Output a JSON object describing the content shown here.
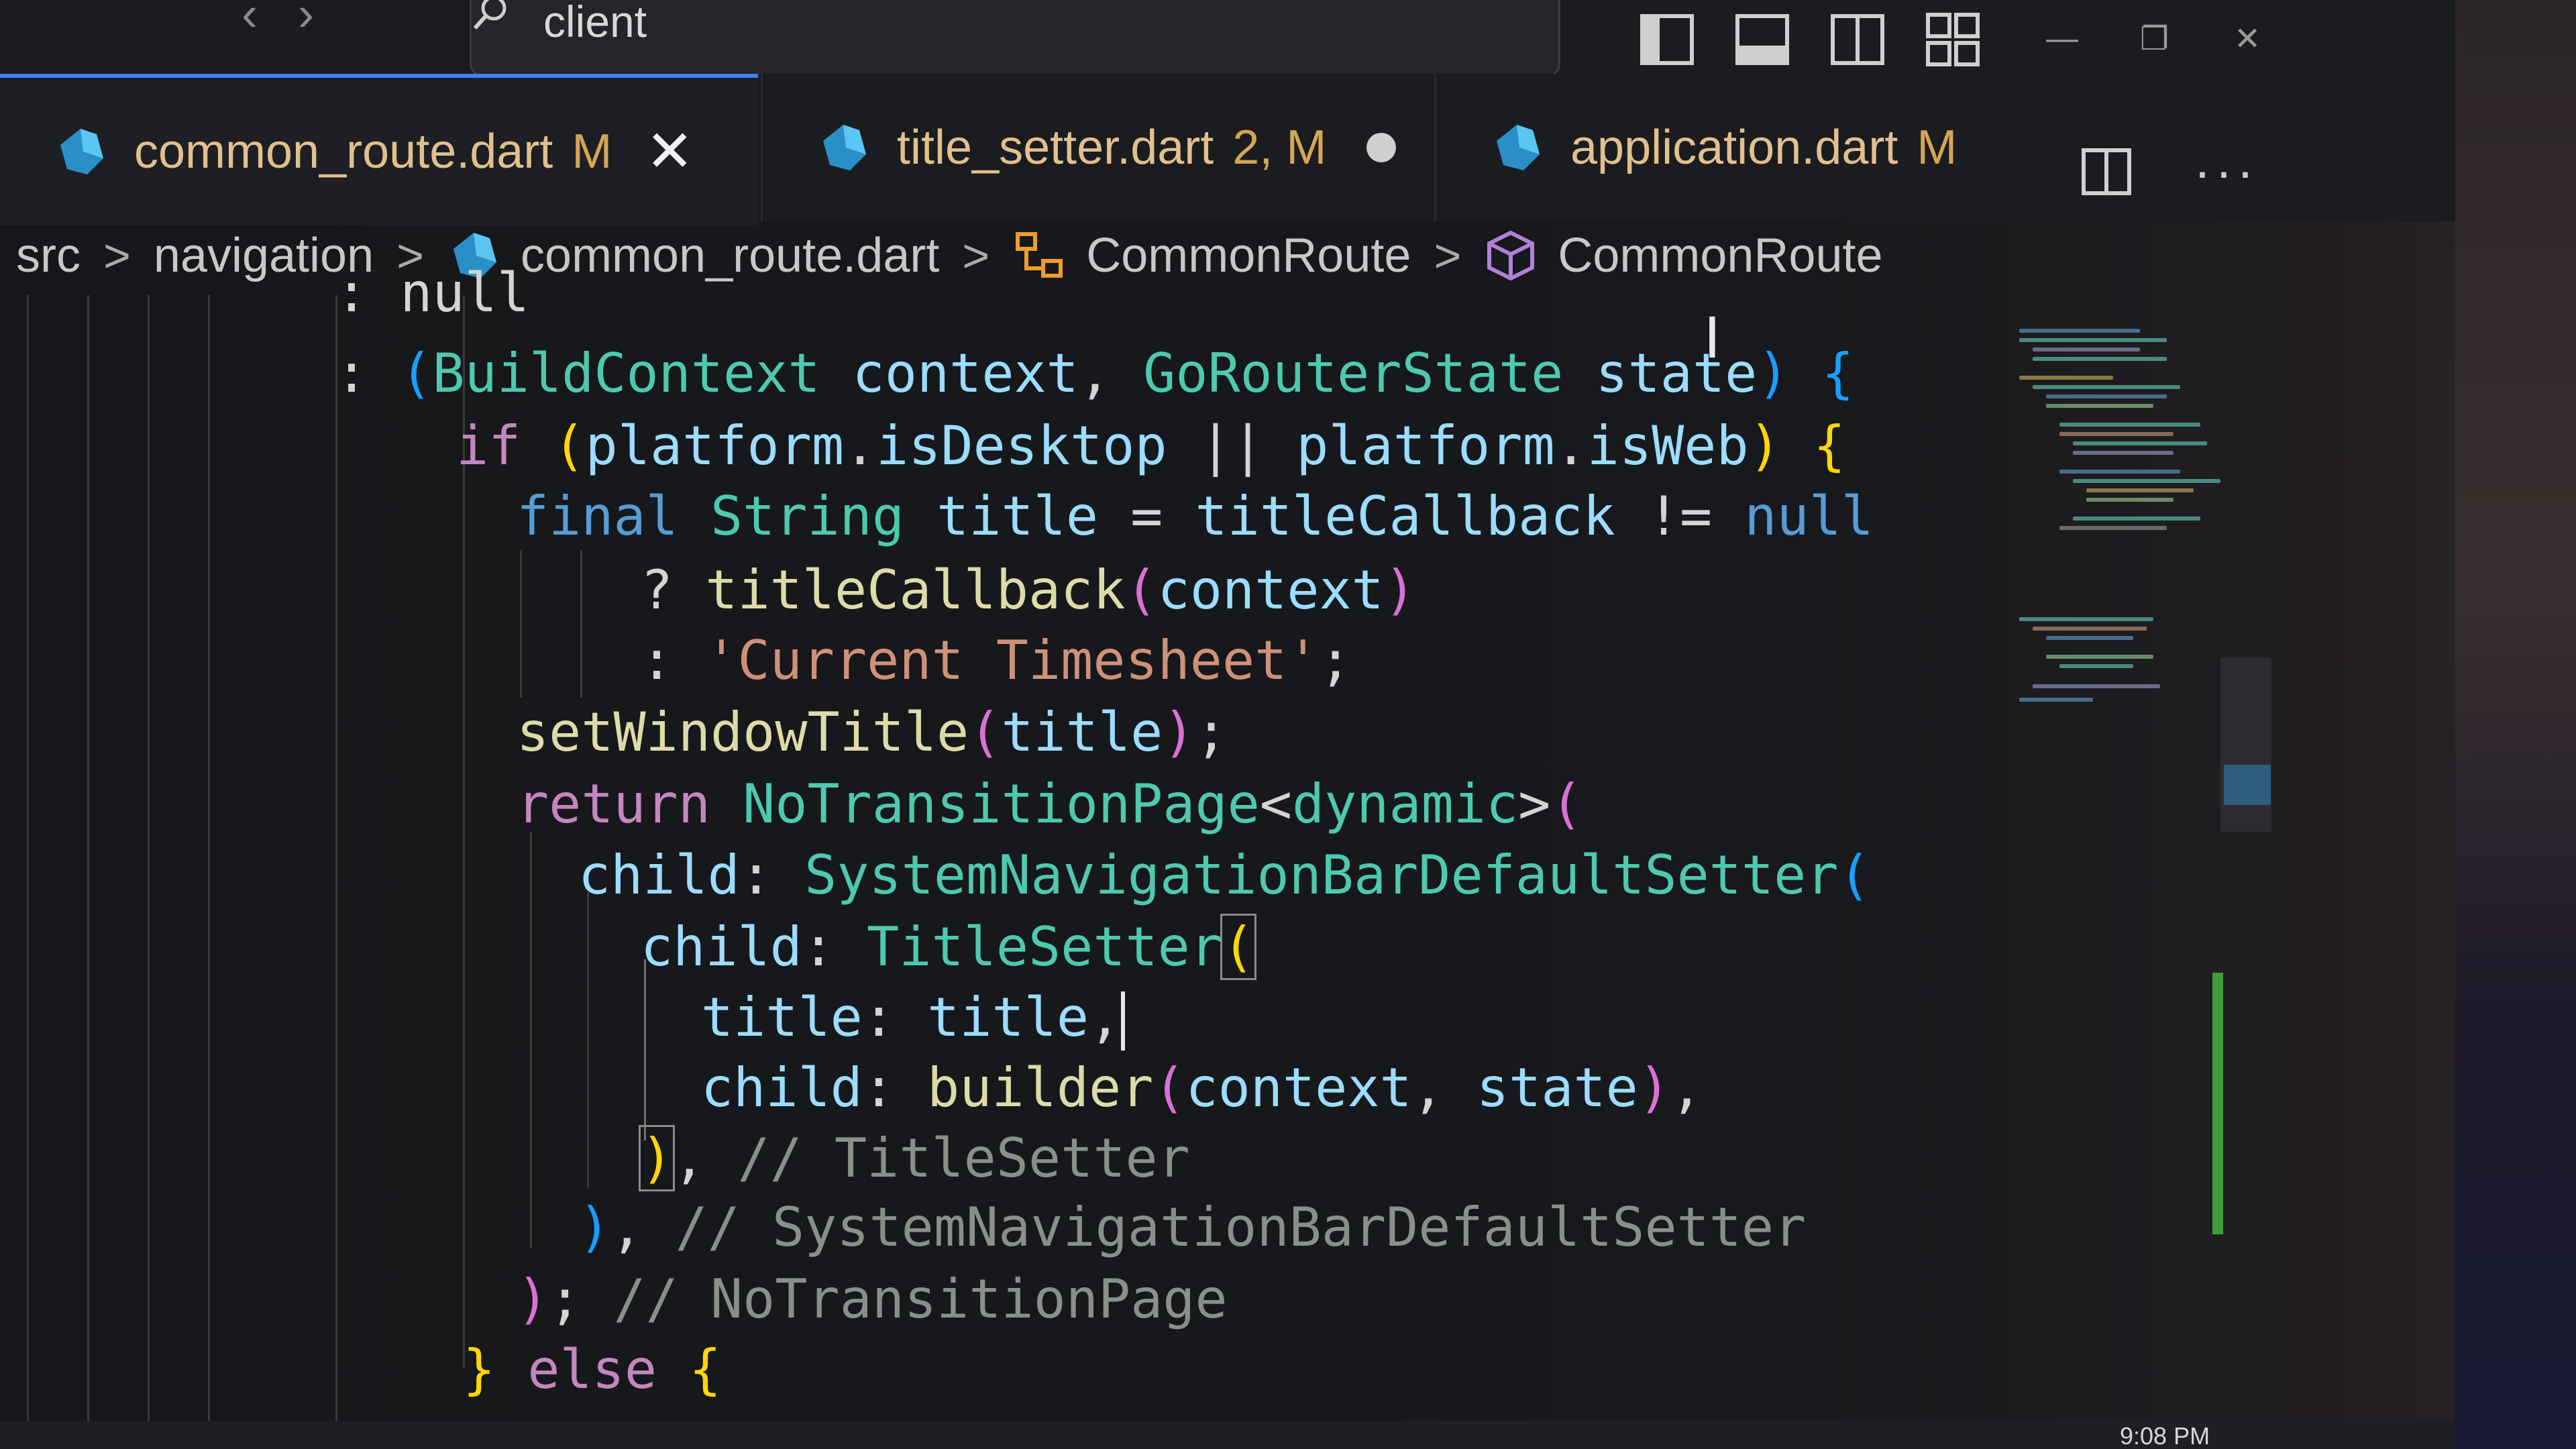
{
  "search": {
    "text": "client"
  },
  "tabs": [
    {
      "name": "common_route.dart",
      "status": "M",
      "active": true
    },
    {
      "name": "title_setter.dart",
      "status": "2, M",
      "unsaved": true
    },
    {
      "name": "application.dart",
      "status": "M"
    }
  ],
  "breadcrumb": {
    "items": [
      "src",
      "navigation",
      "common_route.dart",
      "CommonRoute",
      "CommonRoute"
    ],
    "separator": ">"
  },
  "icons": {
    "tab_file_icon": "dart-file-icon",
    "breadcrumb_class_icon": "class-icon",
    "breadcrumb_member_icon": "cube-icon"
  },
  "code": {
    "partial_top": ": null",
    "colon": ":",
    "paren_open": "(",
    "paren_close": ")",
    "build_context": "BuildContext",
    "context": "context",
    "comma": ",",
    "go_router_state": "GoRouterState",
    "state": "state",
    "brace_open": "{",
    "brace_close": "}",
    "if": "if",
    "platform": "platform",
    "dot": ".",
    "is_desktop": "isDesktop",
    "or": "||",
    "is_web": "isWeb",
    "final": "final",
    "string_type": "String",
    "title": "title",
    "equals": "=",
    "title_callback": "titleCallback",
    "neq": "!=",
    "null": "null",
    "question": "?",
    "current_timesheet": "'Current Timesheet'",
    "semicolon": ";",
    "set_window_title": "setWindowTitle",
    "return": "return",
    "no_transition_page": "NoTransitionPage",
    "lt": "<",
    "dynamic": "dynamic",
    "gt": ">",
    "child": "child",
    "system_nav_setter": "SystemNavigationBarDefaultSetter",
    "title_setter": "TitleSetter",
    "builder": "builder",
    "comment_title_setter": "// TitleSetter",
    "comment_system_nav": "// SystemNavigationBarDefaultSetter",
    "comment_no_transition": "// NoTransitionPage",
    "else": "else"
  },
  "system": {
    "clock": "9:08 PM"
  },
  "colors": {
    "keyword": "#569cd6",
    "control": "#c586c0",
    "type": "#4ec9b0",
    "variable": "#9cdcfe",
    "function": "#dcdcaa",
    "string": "#ce9178",
    "tab_name_modified": "#e2c08d",
    "active_tab_border": "#3b82f6",
    "diff_added": "#3e9f3a"
  }
}
